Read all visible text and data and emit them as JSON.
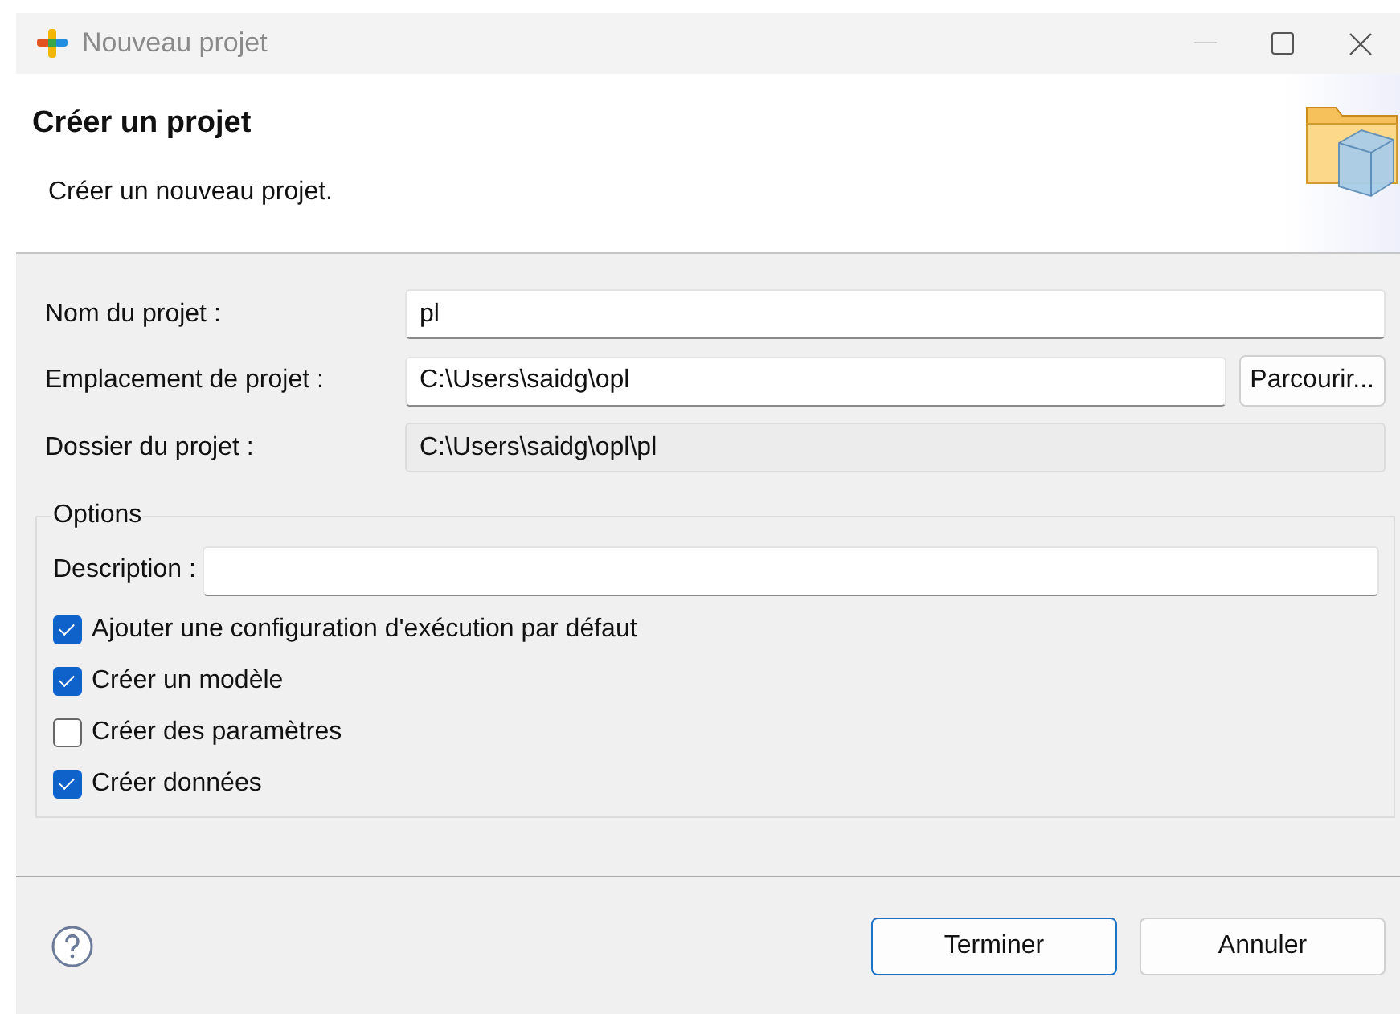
{
  "window": {
    "title": "Nouveau projet"
  },
  "header": {
    "title": "Créer un projet",
    "subtitle": "Créer un nouveau projet."
  },
  "fields": [
    {
      "label": "Nom du projet :",
      "value": "pl",
      "disabled": false
    },
    {
      "label": "Emplacement de projet :",
      "value": "C:\\Users\\saidg\\opl",
      "disabled": false,
      "button": "Parcourir..."
    },
    {
      "label": "Dossier du projet :",
      "value": "C:\\Users\\saidg\\opl\\pl",
      "disabled": true
    }
  ],
  "options": {
    "title": "Options",
    "description": {
      "label": "Description :"
    },
    "checkboxes": [
      {
        "label": "Ajouter une configuration d'exécution par défaut",
        "checked": true
      },
      {
        "label": "Créer un modèle",
        "checked": true
      },
      {
        "label": "Créer des paramètres",
        "checked": false
      },
      {
        "label": "Créer données",
        "checked": true
      }
    ]
  },
  "buttons": [
    {
      "label": "Terminer",
      "default": true
    },
    {
      "label": "Annuler",
      "default": false
    }
  ]
}
